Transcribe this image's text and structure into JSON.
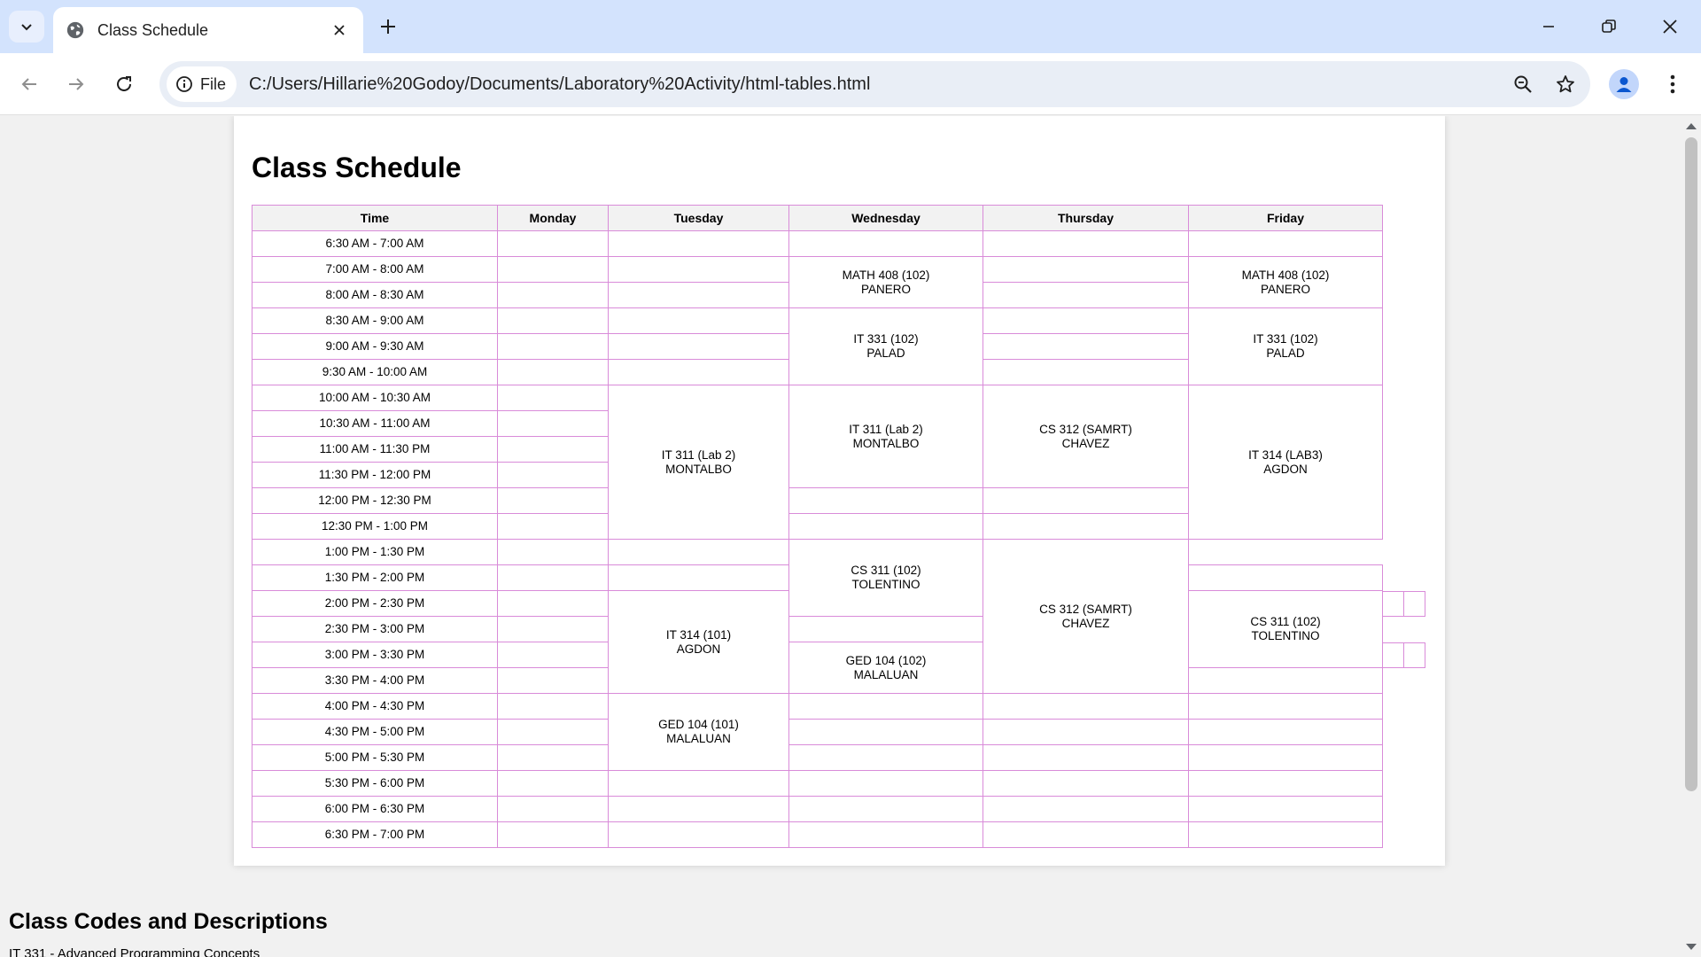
{
  "browser": {
    "tab_title": "Class Schedule",
    "chip_label": "File",
    "url": "C:/Users/Hillarie%20Godoy/Documents/Laboratory%20Activity/html-tables.html"
  },
  "page": {
    "heading": "Class Schedule",
    "section_heading": "Class Codes and Descriptions",
    "section_partial_text": "IT 331 - Advanced Programming Concepts"
  },
  "table": {
    "headers": [
      "Time",
      "Monday",
      "Tuesday",
      "Wednesday",
      "Thursday",
      "Friday"
    ],
    "times": [
      "6:30 AM - 7:00 AM",
      "7:00 AM - 8:00 AM",
      "8:00 AM - 8:30 AM",
      "8:30 AM - 9:00 AM",
      "9:00 AM - 9:30 AM",
      "9:30 AM - 10:00 AM",
      "10:00 AM - 10:30 AM",
      "10:30 AM - 11:00 AM",
      "11:00 AM - 11:30 PM",
      "11:30 PM - 12:00 PM",
      "12:00 PM - 12:30 PM",
      "12:30 PM - 1:00 PM",
      "1:00 PM - 1:30 PM",
      "1:30 PM - 2:00 PM",
      "2:00 PM - 2:30 PM",
      "2:30 PM - 3:00 PM",
      "3:00 PM - 3:30 PM",
      "3:30 PM - 4:00 PM",
      "4:00 PM - 4:30 PM",
      "4:30 PM - 5:00 PM",
      "5:00 PM - 5:30 PM",
      "5:30 PM - 6:00 PM",
      "6:00 PM - 6:30 PM",
      "6:30 PM - 7:00 PM"
    ],
    "classes": {
      "wed_math408": {
        "code": "MATH 408 (102)",
        "instructor": "PANERO"
      },
      "fri_math408": {
        "code": "MATH 408 (102)",
        "instructor": "PANERO"
      },
      "wed_it331": {
        "code": "IT 331 (102)",
        "instructor": "PALAD"
      },
      "fri_it331": {
        "code": "IT 331 (102)",
        "instructor": "PALAD"
      },
      "tue_it311": {
        "code": "IT 311 (Lab 2)",
        "instructor": "MONTALBO"
      },
      "wed_it311": {
        "code": "IT 311 (Lab 2)",
        "instructor": "MONTALBO"
      },
      "thu_cs312_am": {
        "code": "CS 312 (SAMRT)",
        "instructor": "CHAVEZ"
      },
      "fri_it314": {
        "code": "IT 314 (LAB3)",
        "instructor": "AGDON"
      },
      "wed_cs311": {
        "code": "CS 311 (102)",
        "instructor": "TOLENTINO"
      },
      "thu_cs312_pm": {
        "code": "CS 312 (SAMRT)",
        "instructor": "CHAVEZ"
      },
      "fri_cs311": {
        "code": "CS 311 (102)",
        "instructor": "TOLENTINO"
      },
      "tue_it314": {
        "code": "IT 314 (101)",
        "instructor": "AGDON"
      },
      "wed_ged104": {
        "code": "GED 104 (102)",
        "instructor": "MALALUAN"
      },
      "tue_ged104": {
        "code": "GED 104 (101)",
        "instructor": "MALALUAN"
      }
    }
  }
}
